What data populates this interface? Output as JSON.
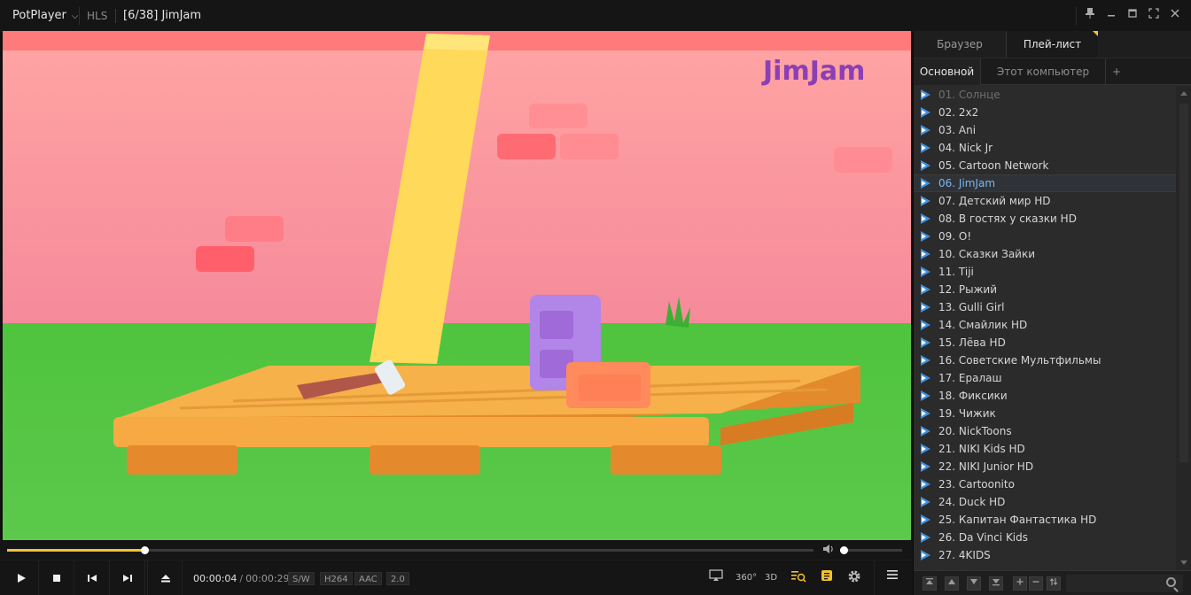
{
  "titlebar": {
    "app_name": "PotPlayer",
    "protocol": "HLS",
    "title": "[6/38] JimJam"
  },
  "player": {
    "logo_text": "JimJam",
    "current_time": "00:00:04",
    "separator": "/",
    "duration": "00:00:29",
    "seek_fraction": 0.17,
    "volume_fraction": 0.06,
    "tags": [
      "S/W",
      "H264",
      "AAC",
      "2.0"
    ],
    "right_icons": {
      "r360": "360°",
      "r3d": "3D"
    }
  },
  "panel": {
    "tabs": [
      "Браузер",
      "Плей-лист"
    ],
    "active_tab": 1,
    "subtabs": [
      "Основной",
      "Этот компьютер",
      "+"
    ],
    "active_subtab": 0,
    "current_index": 5,
    "items": [
      "01. Солнце",
      "02. 2x2",
      "03. Ani",
      "04. Nick Jr",
      "05. Cartoon Network",
      "06. JimJam",
      "07. Детский мир HD",
      "08. В гостях у сказки HD",
      "09. O!",
      "10. Сказки Зайки",
      "11. Tiji",
      "12. Рыжий",
      "13. Gulli Girl",
      "14. Смайлик HD",
      "15. Лёва HD",
      "16. Советские Мультфильмы",
      "17. Ералаш",
      "18. Фиксики",
      "19. Чижик",
      "20. NickToons",
      "21. NIKI Kids HD",
      "22. NIKI Junior HD",
      "23. Cartoonito",
      "24. Duck HD",
      "25. Капитан Фантастика HD",
      "26. Da Vinci Kids",
      "27. 4KIDS"
    ]
  }
}
